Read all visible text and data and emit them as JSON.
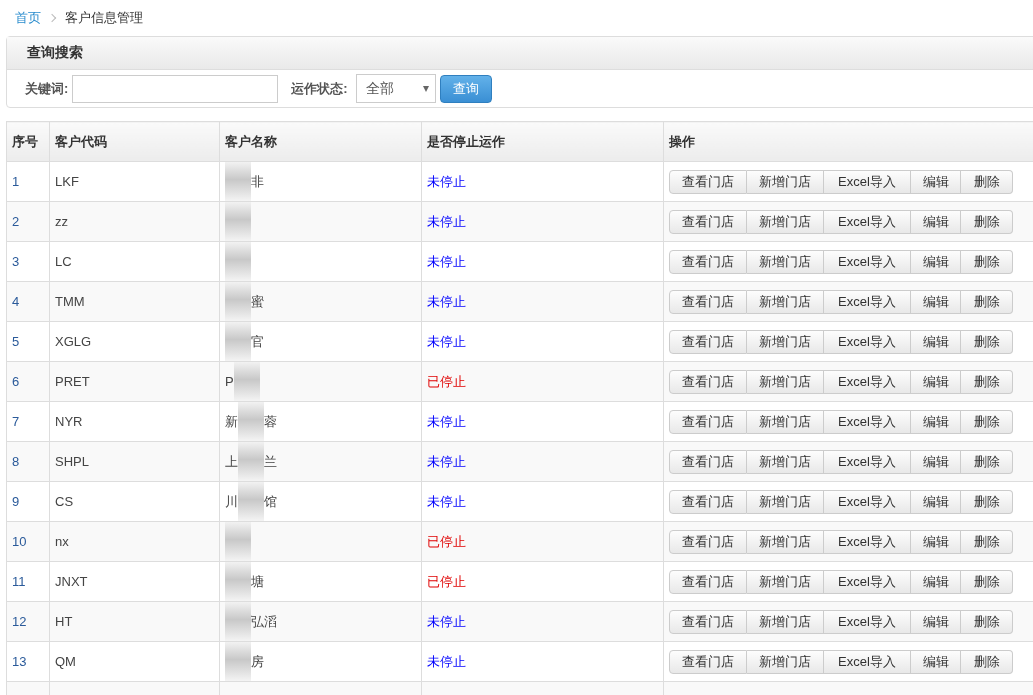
{
  "breadcrumb": [
    {
      "label": "首页",
      "kind": "link"
    },
    {
      "label": "客户信息管理",
      "kind": "current"
    }
  ],
  "search_panel": {
    "title": "查询搜索",
    "keyword_label": "关键词:",
    "status_label": "运作状态:",
    "status_value": "全部",
    "button": "查询"
  },
  "table": {
    "columns": [
      "序号",
      "客户代码",
      "客户名称",
      "是否停止运作",
      "操作"
    ],
    "rows": [
      {
        "no": "1",
        "code": "LKF",
        "name_start": "",
        "name_end": "非",
        "blurred": true,
        "status": "未停止",
        "stopped": false,
        "actions": [
          "查看门店",
          "新增门店",
          "Excel导入",
          "编辑",
          "删除"
        ]
      },
      {
        "no": "2",
        "code": "zz",
        "name_start": "",
        "name_end": "",
        "blurred": true,
        "status": "未停止",
        "stopped": false,
        "actions": [
          "查看门店",
          "新增门店",
          "Excel导入",
          "编辑",
          "删除"
        ]
      },
      {
        "no": "3",
        "code": "LC",
        "name_start": "",
        "name_end": "",
        "blurred": true,
        "status": "未停止",
        "stopped": false,
        "actions": [
          "查看门店",
          "新增门店",
          "Excel导入",
          "编辑",
          "删除"
        ]
      },
      {
        "no": "4",
        "code": "TMM",
        "name_start": "",
        "name_end": "蜜",
        "blurred": true,
        "status": "未停止",
        "stopped": false,
        "actions": [
          "查看门店",
          "新增门店",
          "Excel导入",
          "编辑",
          "删除"
        ]
      },
      {
        "no": "5",
        "code": "XGLG",
        "name_start": "",
        "name_end": "官",
        "blurred": true,
        "status": "未停止",
        "stopped": false,
        "actions": [
          "查看门店",
          "新增门店",
          "Excel导入",
          "编辑",
          "删除"
        ]
      },
      {
        "no": "6",
        "code": "PRET",
        "name_start": "P",
        "name_end": "",
        "blurred": true,
        "status": "已停止",
        "stopped": true,
        "actions": [
          "查看门店",
          "新增门店",
          "Excel导入",
          "编辑",
          "删除"
        ]
      },
      {
        "no": "7",
        "code": "NYR",
        "name_start": "新",
        "name_end": "蓉",
        "blurred": true,
        "status": "未停止",
        "stopped": false,
        "actions": [
          "查看门店",
          "新增门店",
          "Excel导入",
          "编辑",
          "删除"
        ]
      },
      {
        "no": "8",
        "code": "SHPL",
        "name_start": "上",
        "name_end": "兰",
        "blurred": true,
        "status": "未停止",
        "stopped": false,
        "actions": [
          "查看门店",
          "新增门店",
          "Excel导入",
          "编辑",
          "删除"
        ]
      },
      {
        "no": "9",
        "code": "CS",
        "name_start": "川",
        "name_end": "馆",
        "blurred": true,
        "status": "未停止",
        "stopped": false,
        "actions": [
          "查看门店",
          "新增门店",
          "Excel导入",
          "编辑",
          "删除"
        ]
      },
      {
        "no": "10",
        "code": "nx",
        "name_start": "",
        "name_end": "",
        "blurred": true,
        "status": "已停止",
        "stopped": true,
        "actions": [
          "查看门店",
          "新增门店",
          "Excel导入",
          "编辑",
          "删除"
        ]
      },
      {
        "no": "11",
        "code": "JNXT",
        "name_start": "",
        "name_end": "塘",
        "blurred": true,
        "status": "已停止",
        "stopped": true,
        "actions": [
          "查看门店",
          "新增门店",
          "Excel导入",
          "编辑",
          "删除"
        ]
      },
      {
        "no": "12",
        "code": "HT",
        "name_start": "",
        "name_end": "弘滔",
        "blurred": true,
        "status": "未停止",
        "stopped": false,
        "actions": [
          "查看门店",
          "新增门店",
          "Excel导入",
          "编辑",
          "删除"
        ]
      },
      {
        "no": "13",
        "code": "QM",
        "name_start": "",
        "name_end": "房",
        "blurred": true,
        "status": "未停止",
        "stopped": false,
        "actions": [
          "查看门店",
          "新增门店",
          "Excel导入",
          "编辑",
          "删除"
        ]
      }
    ]
  }
}
